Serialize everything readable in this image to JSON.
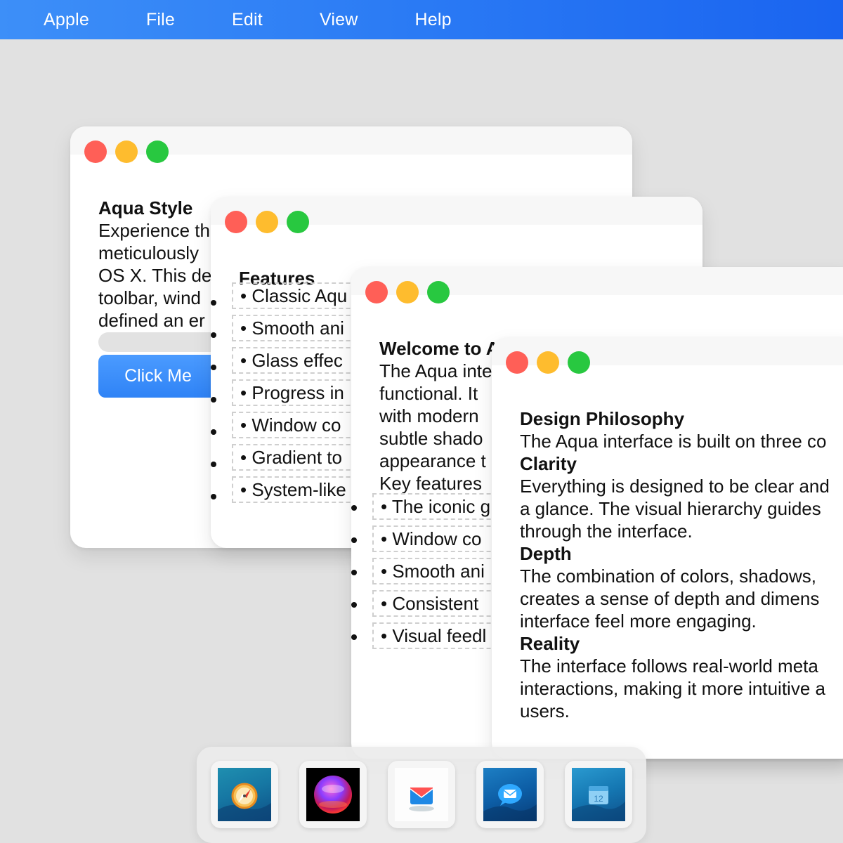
{
  "menubar": {
    "items": [
      "Apple",
      "File",
      "Edit",
      "View",
      "Help"
    ]
  },
  "window1": {
    "title": "Aqua Style",
    "lines": [
      "Experience th",
      "meticulously",
      "OS X. This de",
      "toolbar, wind",
      "defined an er"
    ],
    "button_label": "Click Me"
  },
  "window2": {
    "title": "Features",
    "items": [
      "• Classic Aqu",
      "• Smooth ani",
      "• Glass effec",
      "• Progress in",
      "• Window co",
      "• Gradient to",
      "• System-like"
    ]
  },
  "window3": {
    "title": "Welcome to A",
    "lines": [
      "The Aqua inte",
      "functional. It",
      "with modern",
      "subtle shado",
      "appearance t",
      "Key features"
    ],
    "items": [
      "• The iconic g",
      "• Window co",
      "• Smooth ani",
      "• Consistent",
      "• Visual feedl"
    ]
  },
  "window4": {
    "title": "Design Philosophy",
    "intro": "The Aqua interface is built on three co",
    "sections": [
      {
        "heading": "Clarity",
        "lines": [
          "Everything is designed to be clear and",
          "a glance. The visual hierarchy guides",
          "through the interface."
        ]
      },
      {
        "heading": "Depth",
        "lines": [
          "The combination of colors, shadows,",
          "creates a sense of depth and dimens",
          "interface feel more engaging."
        ]
      },
      {
        "heading": "Reality",
        "lines": [
          "The interface follows real-world meta",
          "interactions, making it more intuitive a",
          "users."
        ]
      }
    ]
  },
  "dock": {
    "apps": [
      "safari-icon",
      "photo-booth-icon",
      "mail-icon",
      "messages-icon",
      "calendar-icon"
    ],
    "calendar_day": "12"
  },
  "colors": {
    "accent": "#2f83f6",
    "close": "#ff5f57",
    "minimize": "#febc2e",
    "zoom": "#28c840"
  }
}
